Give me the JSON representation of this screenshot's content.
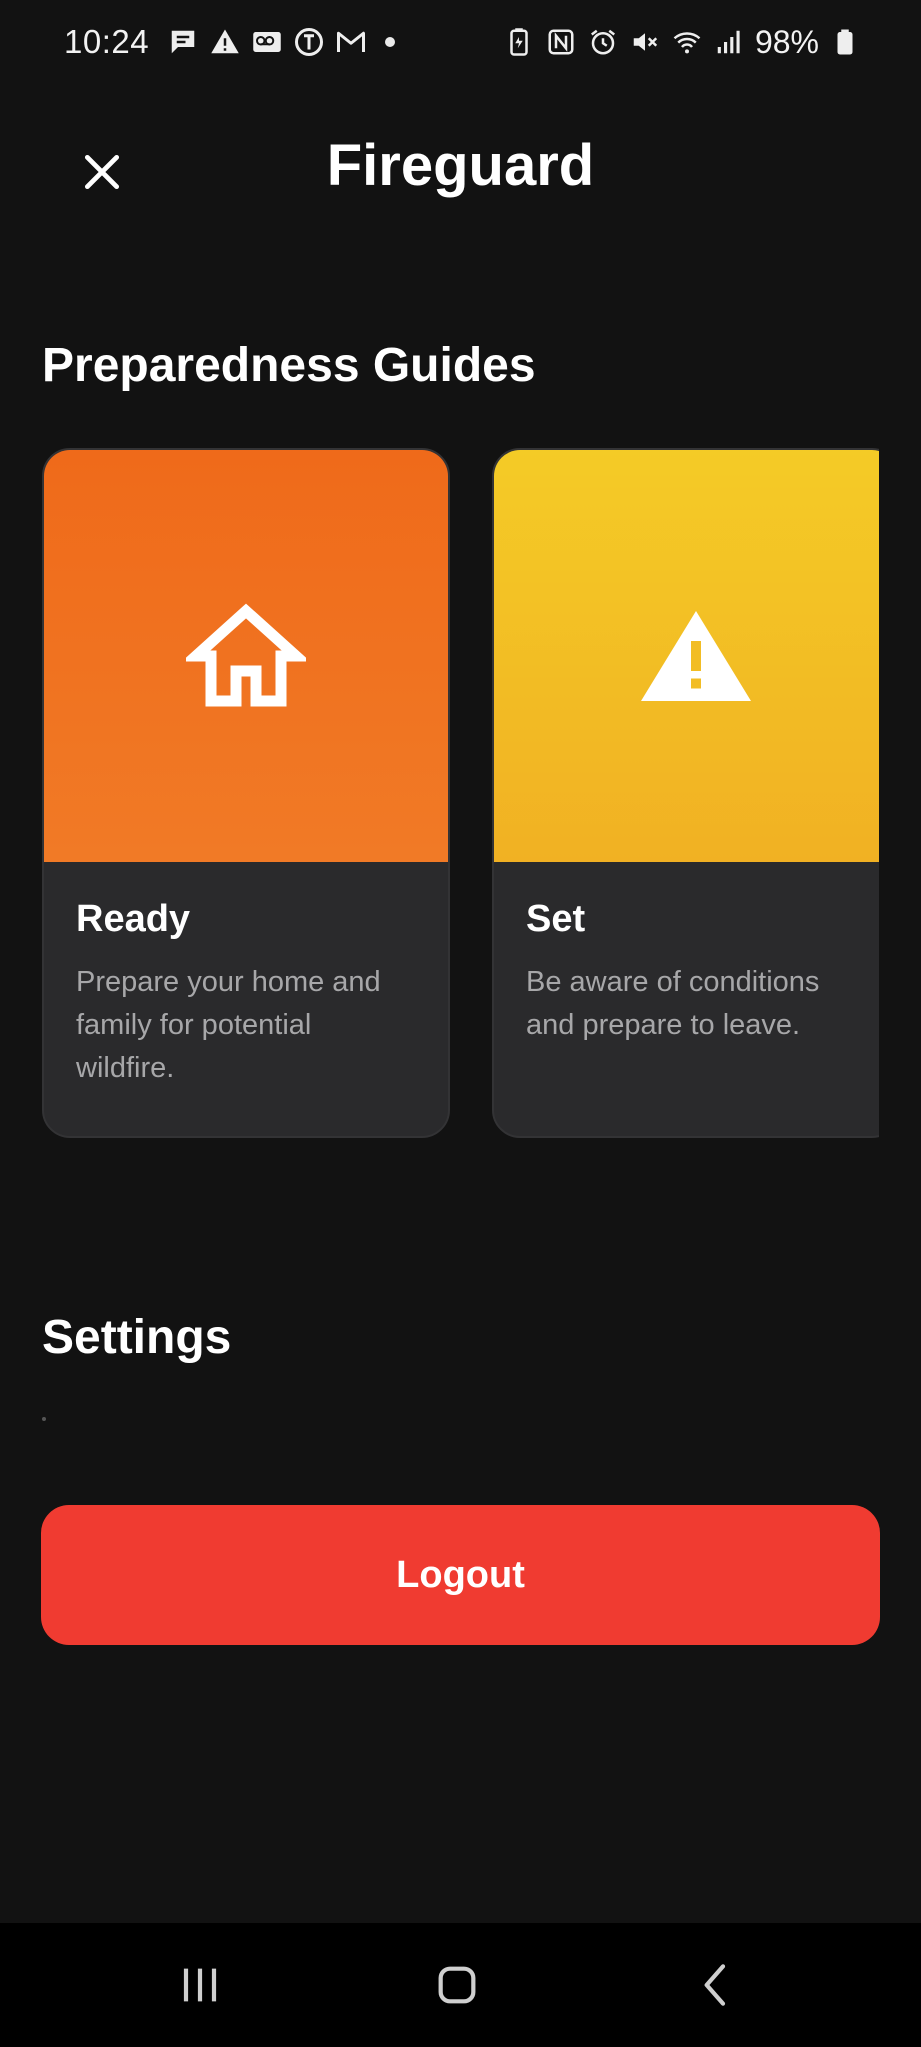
{
  "status_bar": {
    "time": "10:24",
    "battery_percent": "98%",
    "left_icons": [
      "chat-icon",
      "warning-icon",
      "voicemail-icon",
      "nytimes-icon",
      "gmail-icon"
    ],
    "right_icons": [
      "battery-saver-icon",
      "nfc-icon",
      "alarm-icon",
      "mute-icon",
      "wifi-icon",
      "signal-icon",
      "battery-icon"
    ]
  },
  "header": {
    "title": "Fireguard",
    "close_icon": "close-icon"
  },
  "guides": {
    "section_title": "Preparedness Guides",
    "cards": [
      {
        "title": "Ready",
        "description": "Prepare your home and family for potential wildfire.",
        "icon": "home-icon",
        "color": "#ef6a1a"
      },
      {
        "title": "Set",
        "description": "Be aware of conditions and prepare to leave.",
        "icon": "warning-icon",
        "color": "#f4cb26"
      }
    ]
  },
  "settings": {
    "section_title": "Settings"
  },
  "logout": {
    "label": "Logout",
    "color": "#f03b31"
  },
  "nav_bar": {
    "recents_icon": "recents-icon",
    "home_icon": "home-button-icon",
    "back_icon": "back-icon"
  }
}
